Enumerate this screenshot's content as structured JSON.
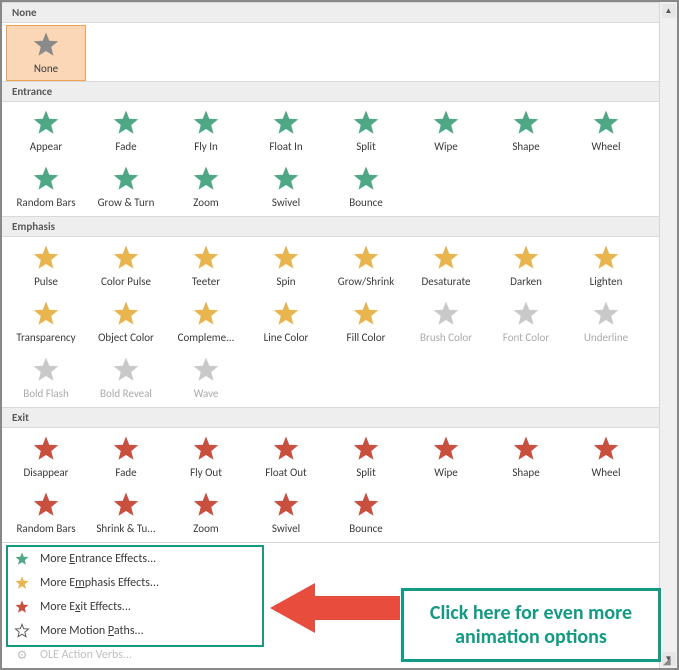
{
  "sections": {
    "none": {
      "title": "None"
    },
    "entrance": {
      "title": "Entrance"
    },
    "emphasis": {
      "title": "Emphasis"
    },
    "exit": {
      "title": "Exit"
    }
  },
  "none_items": [
    {
      "label": "None"
    }
  ],
  "entrance_items": [
    {
      "label": "Appear"
    },
    {
      "label": "Fade"
    },
    {
      "label": "Fly In"
    },
    {
      "label": "Float In"
    },
    {
      "label": "Split"
    },
    {
      "label": "Wipe"
    },
    {
      "label": "Shape"
    },
    {
      "label": "Wheel"
    },
    {
      "label": "Random Bars"
    },
    {
      "label": "Grow & Turn"
    },
    {
      "label": "Zoom"
    },
    {
      "label": "Swivel"
    },
    {
      "label": "Bounce"
    }
  ],
  "emphasis_items": [
    {
      "label": "Pulse"
    },
    {
      "label": "Color Pulse"
    },
    {
      "label": "Teeter"
    },
    {
      "label": "Spin"
    },
    {
      "label": "Grow/Shrink"
    },
    {
      "label": "Desaturate"
    },
    {
      "label": "Darken"
    },
    {
      "label": "Lighten"
    },
    {
      "label": "Transparency"
    },
    {
      "label": "Object Color"
    },
    {
      "label": "Compleme..."
    },
    {
      "label": "Line Color"
    },
    {
      "label": "Fill Color"
    },
    {
      "label": "Brush Color",
      "disabled": true
    },
    {
      "label": "Font Color",
      "disabled": true
    },
    {
      "label": "Underline",
      "disabled": true
    },
    {
      "label": "Bold Flash",
      "disabled": true
    },
    {
      "label": "Bold Reveal",
      "disabled": true
    },
    {
      "label": "Wave",
      "disabled": true
    }
  ],
  "exit_items": [
    {
      "label": "Disappear"
    },
    {
      "label": "Fade"
    },
    {
      "label": "Fly Out"
    },
    {
      "label": "Float Out"
    },
    {
      "label": "Split"
    },
    {
      "label": "Wipe"
    },
    {
      "label": "Shape"
    },
    {
      "label": "Wheel"
    },
    {
      "label": "Random Bars"
    },
    {
      "label": "Shrink & Tu..."
    },
    {
      "label": "Zoom"
    },
    {
      "label": "Swivel"
    },
    {
      "label": "Bounce"
    }
  ],
  "menu": {
    "entrance": "More Entrance Effects...",
    "emphasis": "More Emphasis Effects...",
    "exit": "More Exit Effects...",
    "motion": "More Motion Paths...",
    "ole": "OLE Action Verbs..."
  },
  "callout": "Click here for even more animation options",
  "colors": {
    "none": "#8a8a8a",
    "entrance": "#4ea785",
    "emphasis": "#e8b551",
    "exit": "#c94f3e",
    "disabled": "#c9c9c9",
    "motion": "#555555"
  }
}
